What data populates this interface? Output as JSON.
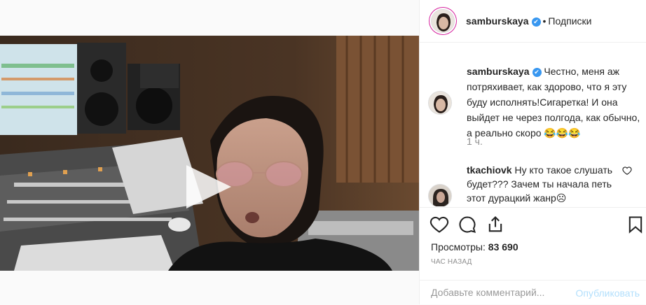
{
  "header": {
    "username": "samburskaya",
    "follow_label": "Подписки",
    "separator": "•",
    "verified_mark": "✔"
  },
  "caption": {
    "username": "samburskaya",
    "text": "Честно, меня аж потряхивает, как здорово, что я эту буду исполнять!Сигаретка! И она выйдет не через полгода, как обычно, а реально скоро 😂😂😂",
    "time": "1 ч."
  },
  "comment": {
    "username": "tkachiovk",
    "text": "Ну кто такое слушать будет??? Зачем ты начала петь этот дурацкий жанр☹"
  },
  "stats": {
    "views_label": "Просмотры:",
    "views_value": "83 690",
    "time_ago": "ЧАС НАЗАД"
  },
  "composer": {
    "placeholder": "Добавьте комментарий...",
    "publish_label": "Опубликовать"
  },
  "icons": [
    "play-icon",
    "verified-icon",
    "like-icon",
    "comment-icon",
    "share-icon",
    "save-icon",
    "small-heart-icon"
  ],
  "colors": {
    "verified": "#3897f0",
    "publish_disabled": "#b2dffc",
    "muted": "#8e8e8e",
    "text": "#262626"
  }
}
